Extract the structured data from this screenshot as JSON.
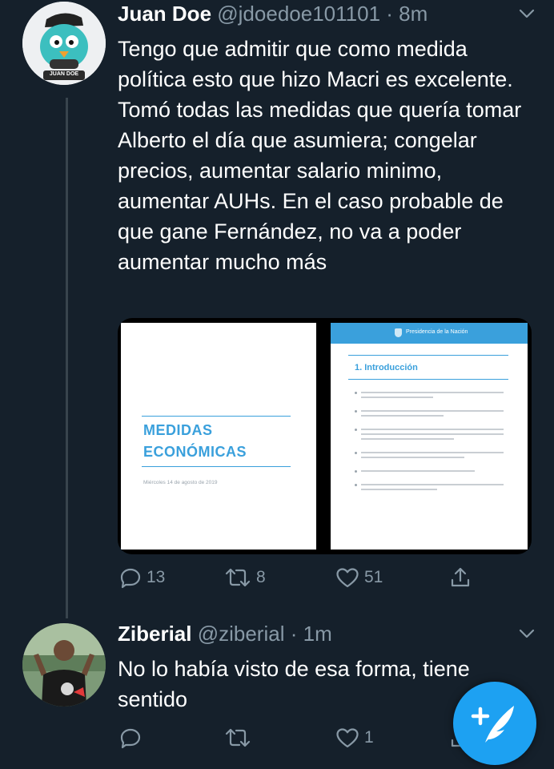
{
  "tweets": [
    {
      "name": "Juan Doe",
      "handle": "@jdoedoe101101",
      "separator": "·",
      "time": "8m",
      "avatar_text": "JUAN DOE",
      "text": "Tengo que admitir que como medida política esto que hizo Macri es excelente. Tomó todas las medidas que quería tomar Alberto el día que asumiera; congelar precios, aumentar salario minimo, aumentar AUHs. En el caso probable de que gane Fernández, no va a poder aumentar mucho más",
      "media": {
        "left_page": {
          "title_line1": "MEDIDAS",
          "title_line2": "ECONÓMICAS",
          "date": "Miércoles 14 de agosto de 2019"
        },
        "right_page": {
          "header": "Presidencia de la Nación",
          "section_title": "1. Introducción"
        }
      },
      "replies": "13",
      "retweets": "8",
      "likes": "51"
    },
    {
      "name": "Ziberial",
      "handle": "@ziberial",
      "separator": "·",
      "time": "1m",
      "text": "No lo había visto de esa forma, tiene sentido",
      "replies": "",
      "retweets": "",
      "likes": "1"
    }
  ],
  "icons": {
    "reply": "reply-icon",
    "retweet": "retweet-icon",
    "like": "heart-icon",
    "share": "share-icon",
    "more": "chevron-down-icon",
    "compose": "compose-tweet-icon"
  },
  "colors": {
    "background": "#15202b",
    "secondary_text": "#8899a6",
    "accent": "#1da1f2",
    "doc_blue": "#3aa0dc"
  }
}
